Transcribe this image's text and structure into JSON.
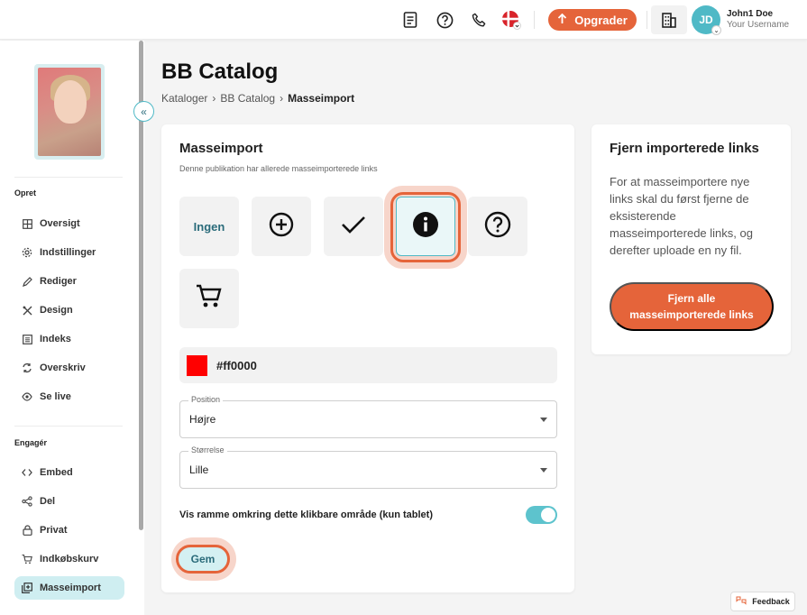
{
  "topbar": {
    "upgrade_label": "Opgrader",
    "user_name": "John1 Doe",
    "user_sub": "Your Username",
    "avatar_initials": "JD",
    "icons": [
      "document-icon",
      "help-icon",
      "phone-icon",
      "danish-flag-icon",
      "rocket-icon",
      "building-icon"
    ]
  },
  "sidebar": {
    "sections": [
      {
        "title": "Opret",
        "items": [
          {
            "label": "Oversigt",
            "icon": "overview-icon"
          },
          {
            "label": "Indstillinger",
            "icon": "settings-icon"
          },
          {
            "label": "Rediger",
            "icon": "edit-icon"
          },
          {
            "label": "Design",
            "icon": "design-icon"
          },
          {
            "label": "Indeks",
            "icon": "index-icon"
          },
          {
            "label": "Overskriv",
            "icon": "overwrite-icon"
          },
          {
            "label": "Se live",
            "icon": "eye-icon"
          }
        ]
      },
      {
        "title": "Engagér",
        "items": [
          {
            "label": "Embed",
            "icon": "code-icon"
          },
          {
            "label": "Del",
            "icon": "share-icon"
          },
          {
            "label": "Privat",
            "icon": "lock-icon"
          },
          {
            "label": "Indkøbskurv",
            "icon": "cart-icon"
          },
          {
            "label": "Masseimport",
            "icon": "import-icon",
            "active": true
          }
        ]
      }
    ]
  },
  "page": {
    "title": "BB Catalog",
    "breadcrumb": [
      "Kataloger",
      "BB Catalog",
      "Masseimport"
    ]
  },
  "main_card": {
    "title": "Masseimport",
    "subtitle": "Denne publikation har allerede masseimporterede links",
    "icon_options": [
      {
        "label": "Ingen",
        "icon": "none"
      },
      {
        "icon": "plus-circle-icon"
      },
      {
        "icon": "checkmark-icon"
      },
      {
        "icon": "info-icon",
        "selected": true
      },
      {
        "icon": "question-icon"
      },
      {
        "icon": "cart-icon"
      }
    ],
    "color_value": "#ff0000",
    "position": {
      "label": "Position",
      "value": "Højre"
    },
    "size": {
      "label": "Størrelse",
      "value": "Lille"
    },
    "toggle_label": "Vis ramme omkring dette klikbare område (kun tablet)",
    "toggle_on": true,
    "save_label": "Gem"
  },
  "side_card": {
    "title": "Fjern importerede links",
    "text": "For at masseimportere nye links skal du først fjerne de eksisterende masseimporterede links, og derefter uploade en ny fil.",
    "button_label": "Fjern alle masseimporterede links"
  },
  "feedback_label": "Feedback",
  "colors": {
    "accent": "#e5643a",
    "teal": "#4fb9c6",
    "active_bg": "#cfeef1"
  }
}
